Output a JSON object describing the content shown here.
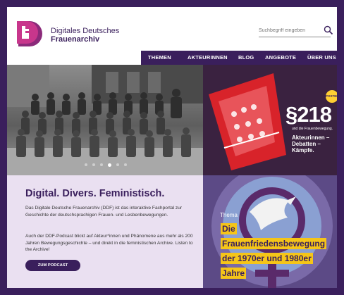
{
  "brand": {
    "line1": "Digitales Deutsches",
    "line2": "Frauenarchiv",
    "accent_color": "#3a1f5c",
    "logo_color": "#c8368c"
  },
  "search": {
    "placeholder": "Suchbegriff eingeben",
    "icon": "search-icon"
  },
  "nav": {
    "items": [
      "THEMEN",
      "AKTEURINNEN",
      "BLOG",
      "ANGEBOTE",
      "ÜBER UNS"
    ]
  },
  "hero": {
    "carousel_dots": 6,
    "active_dot": 3
  },
  "poster": {
    "paragraph": "§218",
    "badge": "POSTERS",
    "subtitle": "und die Frauenbewegung.",
    "headline": "Akteurinnen – Debatten – Kämpfe."
  },
  "intro": {
    "heading": "Digital. Divers. Feministisch.",
    "para1": "Das Digitale Deutsche Frauenarchiv (DDF) ist das interaktive Fachportal zur Geschichte der deutschsprachigen Frauen- und Lesbenbewegungen.",
    "para2": "Auch der DDF-Podcast blickt auf Akteur*innen und Phänomene aus mehr als 200 Jahren Bewegungsgeschichte – und direkt in die feministischen Archive. Listen to the Archive!",
    "button": "ZUM PODCAST"
  },
  "theme": {
    "label": "Thema",
    "lines": [
      "Die",
      "Frauenfriedensbewegung",
      "der 1970er und 1980er",
      "Jahre"
    ],
    "highlight_color": "#f5c518"
  }
}
